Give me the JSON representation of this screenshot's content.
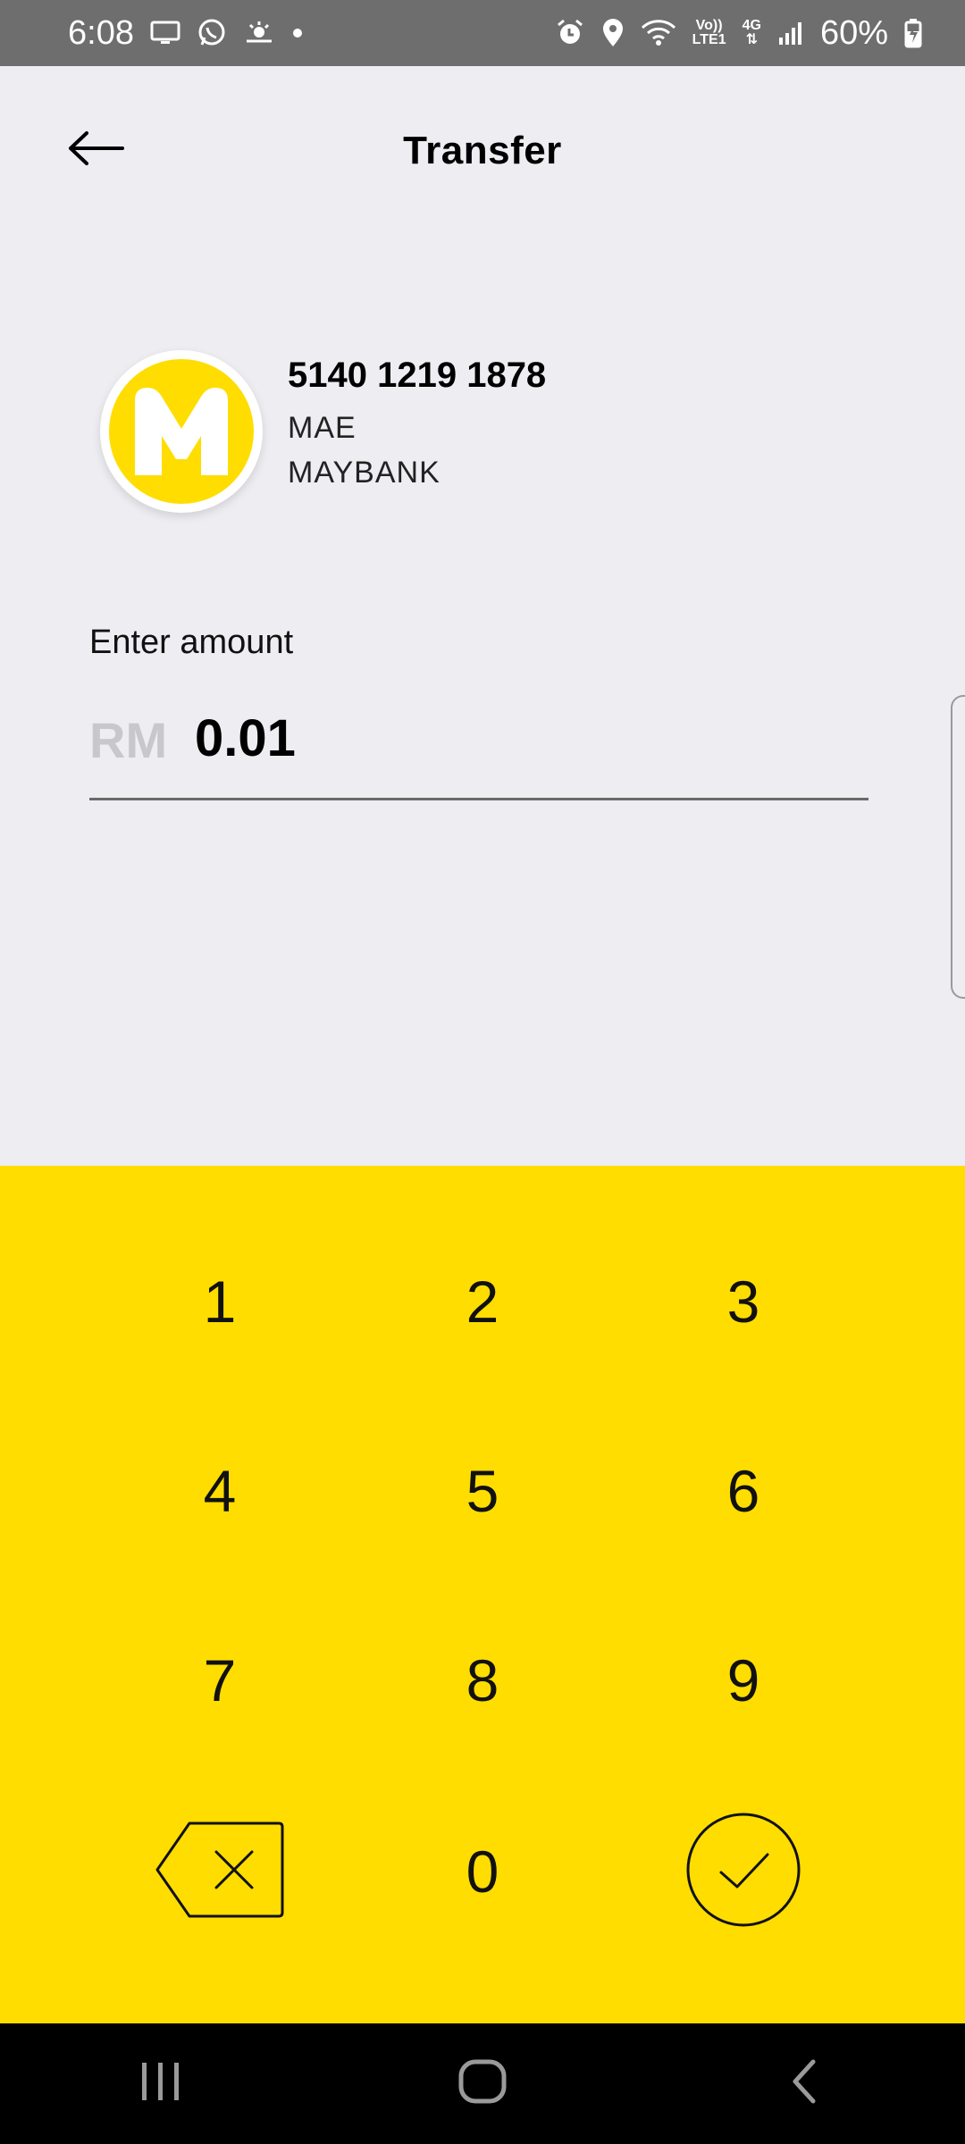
{
  "status_bar": {
    "time": "6:08",
    "network_top": "Vo))",
    "network_bottom": "LTE1",
    "network_type": "4G",
    "battery": "60%",
    "icons_left": [
      "monitor-icon",
      "whatsapp-icon",
      "weather-icon",
      "dot-icon"
    ],
    "icons_right": [
      "alarm-icon",
      "location-icon",
      "wifi-icon",
      "signal-icon",
      "battery-charging-icon"
    ]
  },
  "header": {
    "title": "Transfer",
    "back_icon": "arrow-left-icon"
  },
  "recipient": {
    "logo_letter": "M",
    "account_number": "5140 1219 1878",
    "name": "MAE",
    "bank": "MAYBANK"
  },
  "amount": {
    "label": "Enter amount",
    "currency": "RM",
    "value": "0.01"
  },
  "keypad": {
    "keys": [
      "1",
      "2",
      "3",
      "4",
      "5",
      "6",
      "7",
      "8",
      "9",
      "0"
    ],
    "delete_icon": "backspace-icon",
    "confirm_icon": "check-circle-icon"
  },
  "nav_bar": {
    "icons": [
      "recent-apps-icon",
      "home-icon",
      "back-icon"
    ]
  },
  "colors": {
    "accent": "#FFDD00",
    "background": "#EDEDF2",
    "status_bar": "#6E6E6E"
  }
}
